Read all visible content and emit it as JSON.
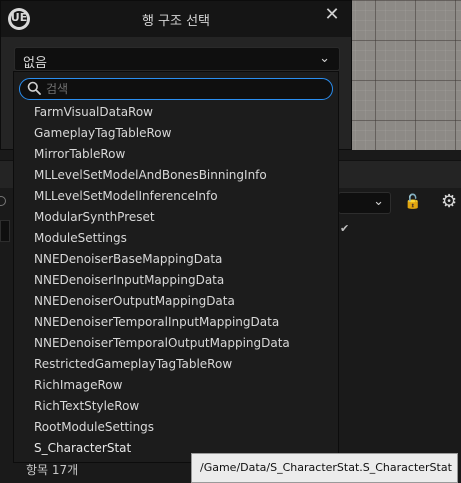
{
  "dialog": {
    "title": "행 구조 선택",
    "logo": "UE",
    "close": "✕",
    "combo_value": "없음",
    "combo_chevron": "⌄"
  },
  "search": {
    "placeholder": "검색",
    "value": ""
  },
  "items": [
    "FarmVisualDataRow",
    "GameplayTagTableRow",
    "MirrorTableRow",
    "MLLevelSetModelAndBonesBinningInfo",
    "MLLevelSetModelInferenceInfo",
    "ModularSynthPreset",
    "ModuleSettings",
    "NNEDenoiserBaseMappingData",
    "NNEDenoiserInputMappingData",
    "NNEDenoiserOutputMappingData",
    "NNEDenoiserTemporalInputMappingData",
    "NNEDenoiserTemporalOutputMappingData",
    "RestrictedGameplayTagTableRow",
    "RichImageRow",
    "RichTextStyleRow",
    "RootModuleSettings",
    "S_CharacterStat"
  ],
  "footer": {
    "count": "항목 17개"
  },
  "tooltip": {
    "text": "/Game/Data/S_CharacterStat.S_CharacterStat"
  },
  "background": {
    "dropdown_chevron": "⌄",
    "lock_icon": "🔓",
    "gear_icon": "⚙",
    "check_icon": "✔"
  },
  "colors": {
    "focus": "#2a8ef0",
    "panel": "#242424",
    "input_bg": "#0f0f0f"
  }
}
